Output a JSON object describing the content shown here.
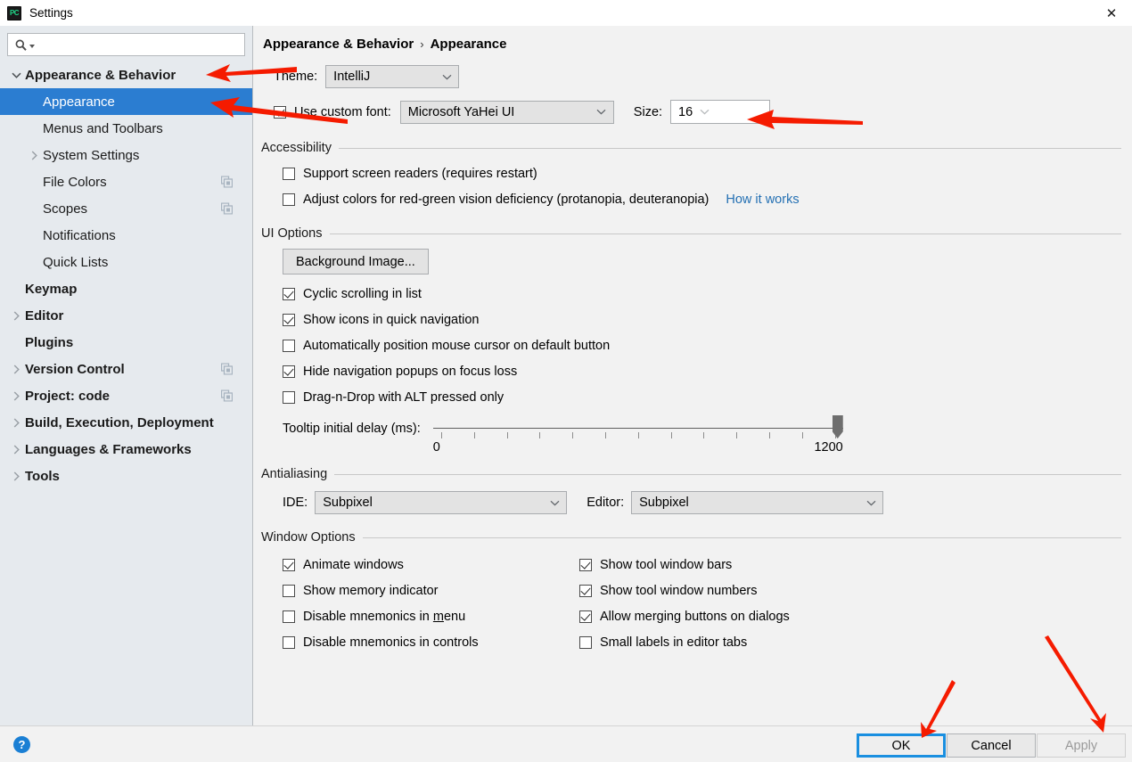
{
  "window": {
    "title": "Settings",
    "app_icon": "pycharm-logo-icon",
    "app_icon_text": "PC",
    "close_icon": "✕"
  },
  "sidebar": {
    "search": {
      "placeholder": "",
      "value": "",
      "icon": "search-icon"
    },
    "items": [
      {
        "label": "Appearance & Behavior",
        "level": 0,
        "bold": true,
        "twisty": "expanded",
        "selected": false,
        "badge": false
      },
      {
        "label": "Appearance",
        "level": 1,
        "bold": false,
        "twisty": "none",
        "selected": true,
        "badge": false
      },
      {
        "label": "Menus and Toolbars",
        "level": 1,
        "bold": false,
        "twisty": "none",
        "selected": false,
        "badge": false
      },
      {
        "label": "System Settings",
        "level": 1,
        "bold": false,
        "twisty": "collapsed",
        "selected": false,
        "badge": false
      },
      {
        "label": "File Colors",
        "level": 1,
        "bold": false,
        "twisty": "none",
        "selected": false,
        "badge": true
      },
      {
        "label": "Scopes",
        "level": 1,
        "bold": false,
        "twisty": "none",
        "selected": false,
        "badge": true
      },
      {
        "label": "Notifications",
        "level": 1,
        "bold": false,
        "twisty": "none",
        "selected": false,
        "badge": false
      },
      {
        "label": "Quick Lists",
        "level": 1,
        "bold": false,
        "twisty": "none",
        "selected": false,
        "badge": false
      },
      {
        "label": "Keymap",
        "level": 0,
        "bold": true,
        "twisty": "none",
        "selected": false,
        "badge": false
      },
      {
        "label": "Editor",
        "level": 0,
        "bold": true,
        "twisty": "collapsed",
        "selected": false,
        "badge": false
      },
      {
        "label": "Plugins",
        "level": 0,
        "bold": true,
        "twisty": "none",
        "selected": false,
        "badge": false
      },
      {
        "label": "Version Control",
        "level": 0,
        "bold": true,
        "twisty": "collapsed",
        "selected": false,
        "badge": true
      },
      {
        "label": "Project: code",
        "level": 0,
        "bold": true,
        "twisty": "collapsed",
        "selected": false,
        "badge": true
      },
      {
        "label": "Build, Execution, Deployment",
        "level": 0,
        "bold": true,
        "twisty": "collapsed",
        "selected": false,
        "badge": false
      },
      {
        "label": "Languages & Frameworks",
        "level": 0,
        "bold": true,
        "twisty": "collapsed",
        "selected": false,
        "badge": false
      },
      {
        "label": "Tools",
        "level": 0,
        "bold": true,
        "twisty": "collapsed",
        "selected": false,
        "badge": false
      }
    ]
  },
  "breadcrumb": {
    "root": "Appearance & Behavior",
    "separator": "›",
    "current": "Appearance"
  },
  "theme": {
    "label": "Theme:",
    "value": "IntelliJ"
  },
  "font": {
    "checkbox_label": "Use custom font:",
    "checked": true,
    "value": "Microsoft YaHei UI",
    "size_label": "Size:",
    "size_value": "16"
  },
  "accessibility": {
    "title": "Accessibility",
    "items": [
      {
        "label": "Support screen readers (requires restart)",
        "checked": false
      },
      {
        "label": "Adjust colors for red-green vision deficiency (protanopia, deuteranopia)",
        "checked": false
      }
    ],
    "link": "How it works"
  },
  "ui_options": {
    "title": "UI Options",
    "background_button": "Background Image...",
    "items": [
      {
        "label": "Cyclic scrolling in list",
        "checked": true
      },
      {
        "label": "Show icons in quick navigation",
        "checked": true
      },
      {
        "label": "Automatically position mouse cursor on default button",
        "checked": false
      },
      {
        "label": "Hide navigation popups on focus loss",
        "checked": true
      },
      {
        "label": "Drag-n-Drop with ALT pressed only",
        "checked": false
      }
    ],
    "slider": {
      "label": "Tooltip initial delay (ms):",
      "min_label": "0",
      "max_label": "1200",
      "min": 0,
      "max": 1200,
      "value": 1200,
      "ticks": 13
    }
  },
  "antialiasing": {
    "title": "Antialiasing",
    "ide_label": "IDE:",
    "ide_value": "Subpixel",
    "editor_label": "Editor:",
    "editor_value": "Subpixel"
  },
  "window_options": {
    "title": "Window Options",
    "left": [
      {
        "label": "Animate windows",
        "checked": true,
        "mnemonic": ""
      },
      {
        "label": "Show memory indicator",
        "checked": false,
        "mnemonic": ""
      },
      {
        "label": "Disable mnemonics in menu",
        "checked": false,
        "mnemonic": "m"
      },
      {
        "label": "Disable mnemonics in controls",
        "checked": false,
        "mnemonic": ""
      }
    ],
    "right": [
      {
        "label": "Show tool window bars",
        "checked": true
      },
      {
        "label": "Show tool window numbers",
        "checked": true
      },
      {
        "label": "Allow merging buttons on dialogs",
        "checked": true
      },
      {
        "label": "Small labels in editor tabs",
        "checked": false
      }
    ]
  },
  "footer": {
    "help": "?",
    "ok": "OK",
    "cancel": "Cancel",
    "apply": "Apply",
    "apply_disabled": true
  },
  "colors": {
    "selection_blue": "#2b7dd1",
    "link_blue": "#2470b3",
    "annotation_red": "#f51b00",
    "focus_blue": "#1a8fe0",
    "sidebar_bg": "#e6eaee",
    "panel_bg": "#f2f2f2"
  },
  "annotations": [
    {
      "name": "arrow-to-appearance-behavior",
      "target": "Appearance & Behavior"
    },
    {
      "name": "arrow-to-appearance-item",
      "target": "Appearance"
    },
    {
      "name": "arrow-to-font-size",
      "target": "Size field"
    },
    {
      "name": "arrow-to-ok-button",
      "target": "OK"
    },
    {
      "name": "arrow-to-apply-button",
      "target": "Apply"
    }
  ]
}
